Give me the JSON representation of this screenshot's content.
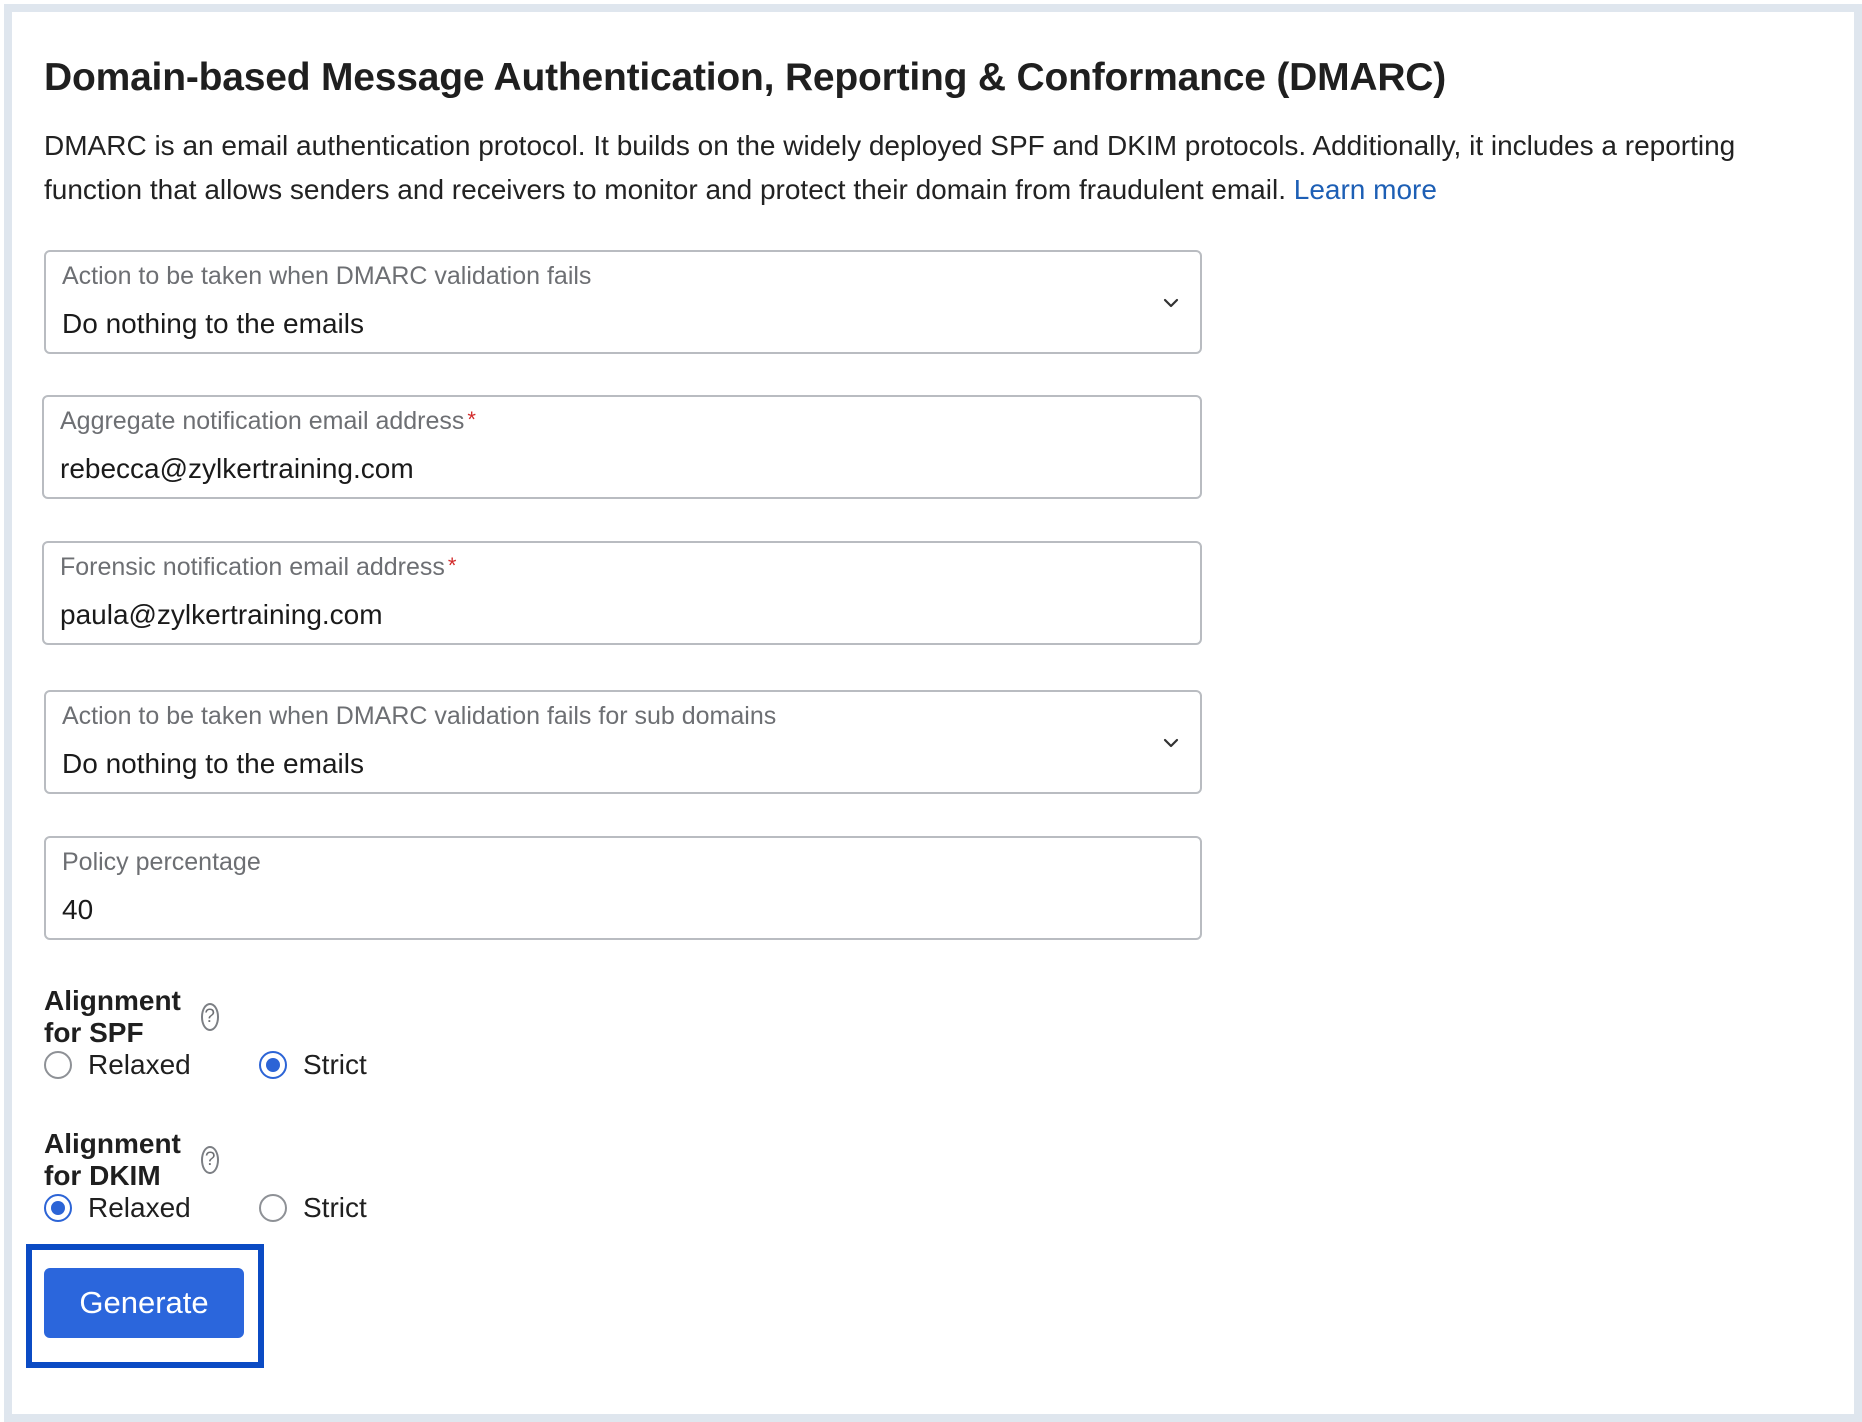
{
  "page": {
    "title": "Domain-based Message Authentication, Reporting & Conformance (DMARC)",
    "description": "DMARC is an email authentication protocol. It builds on the widely deployed SPF and DKIM protocols. Additionally, it includes a reporting function that allows senders and receivers to monitor and protect their domain from fraudulent email.",
    "learn_more": "Learn more"
  },
  "form": {
    "action": {
      "label": "Action to be taken when DMARC validation fails",
      "value": "Do nothing to the emails"
    },
    "aggregate": {
      "label": "Aggregate notification email address",
      "required_mark": "*",
      "value": "rebecca@zylkertraining.com"
    },
    "forensic": {
      "label": "Forensic notification email address",
      "required_mark": "*",
      "value": "paula@zylkertraining.com"
    },
    "sub_action": {
      "label": "Action to be taken when DMARC validation fails for sub domains",
      "value": "Do nothing to the emails"
    },
    "policy": {
      "label": "Policy percentage",
      "value": "40"
    },
    "spf": {
      "title": "Alignment for SPF",
      "help": "?",
      "options": [
        "Relaxed",
        "Strict"
      ],
      "selected": "Strict"
    },
    "dkim": {
      "title": "Alignment for DKIM",
      "help": "?",
      "options": [
        "Relaxed",
        "Strict"
      ],
      "selected": "Relaxed"
    },
    "generate_label": "Generate"
  },
  "colors": {
    "accent": "#2b66dc",
    "highlight": "#0b4bc4",
    "link": "#1d5fb5",
    "required": "#d22a2a"
  },
  "icons": {
    "dropdown": "chevron-down-icon",
    "help": "help-circle-icon"
  }
}
